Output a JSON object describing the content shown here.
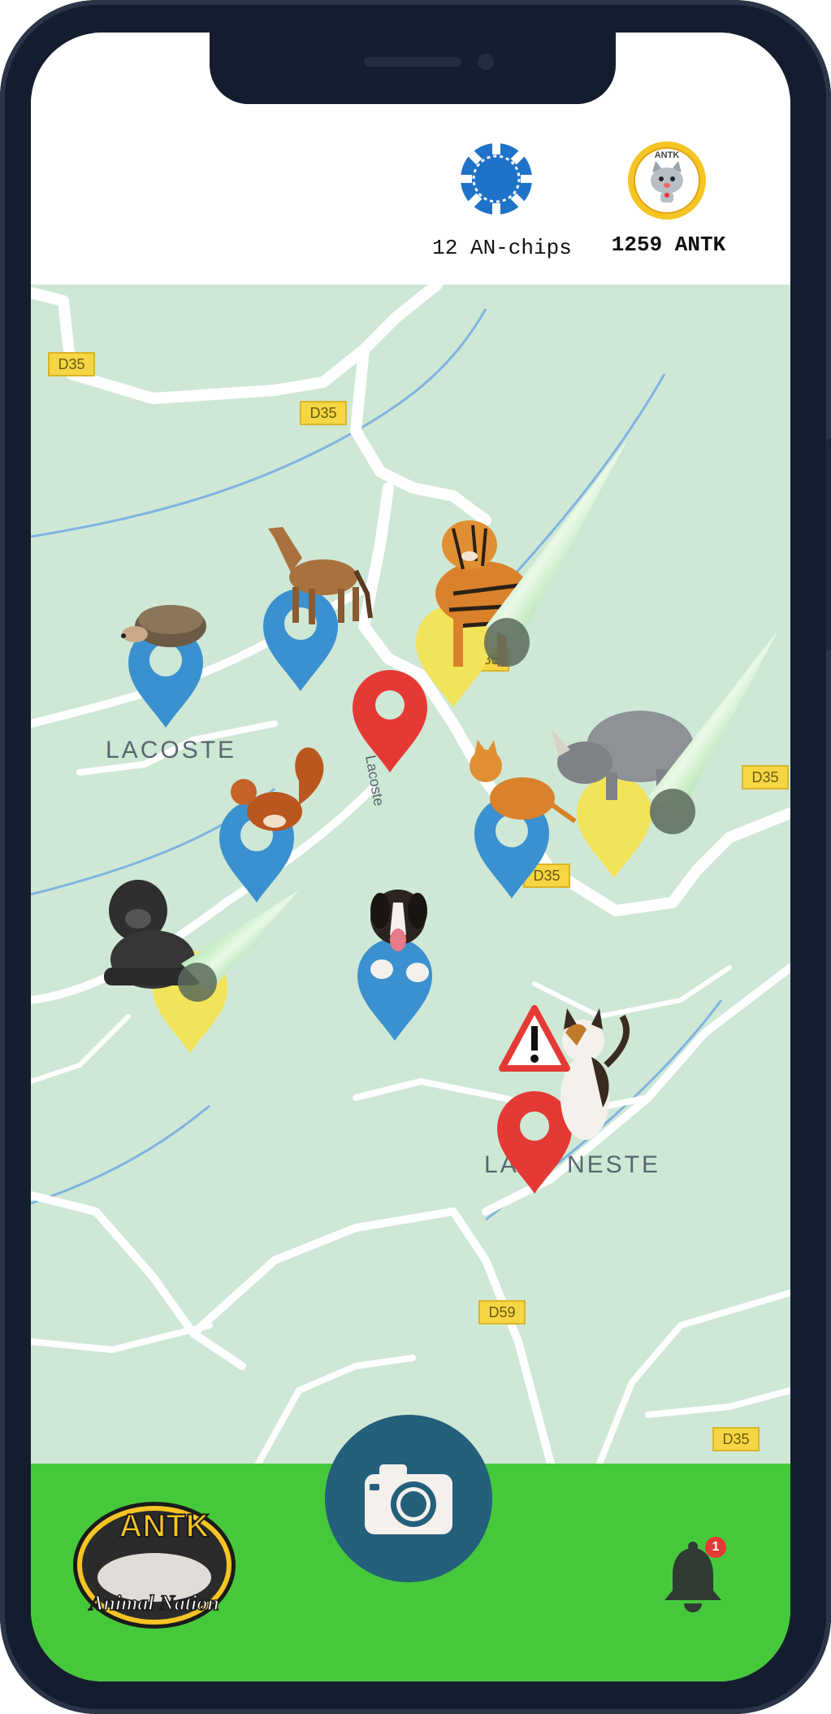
{
  "header": {
    "chips_label": "12 AN-chips",
    "antk_label": "1259 ANTK",
    "antk_badge_text": "ANTK"
  },
  "map": {
    "road_labels": [
      "D35",
      "D35",
      "D35",
      "D35",
      "D35",
      "D35",
      "D59"
    ],
    "place_labels": [
      "LACOSTE",
      "LA",
      "NESTE"
    ],
    "street_label": "Lacoste",
    "colors": {
      "land": "#cfe8d6",
      "road": "#ffffff",
      "water": "#7fb3e0",
      "blue_pin": "#3b91cf",
      "yellow_pin": "#f2e45a",
      "red_pin": "#e53935",
      "shield": "#f6d644"
    },
    "markers": [
      {
        "animal": "hedgehog",
        "pin": "blue"
      },
      {
        "animal": "horse",
        "pin": "blue"
      },
      {
        "animal": "tiger",
        "pin": "yellow",
        "cone": "green"
      },
      {
        "animal": "none",
        "pin": "red"
      },
      {
        "animal": "cat-orange",
        "pin": "blue"
      },
      {
        "animal": "rhinoceros",
        "pin": "yellow",
        "cone": "green"
      },
      {
        "animal": "squirrel",
        "pin": "blue"
      },
      {
        "animal": "gorilla",
        "pin": "yellow",
        "cone": "green"
      },
      {
        "animal": "dog",
        "pin": "blue"
      },
      {
        "animal": "cat-calico",
        "pin": "red",
        "alert": "warning-icon"
      }
    ]
  },
  "footer": {
    "logo_top": "ANTK",
    "logo_bottom": "Animal Nation",
    "notification_count": "1",
    "bar_color": "#45c93b",
    "camera_color": "#245f7c"
  }
}
